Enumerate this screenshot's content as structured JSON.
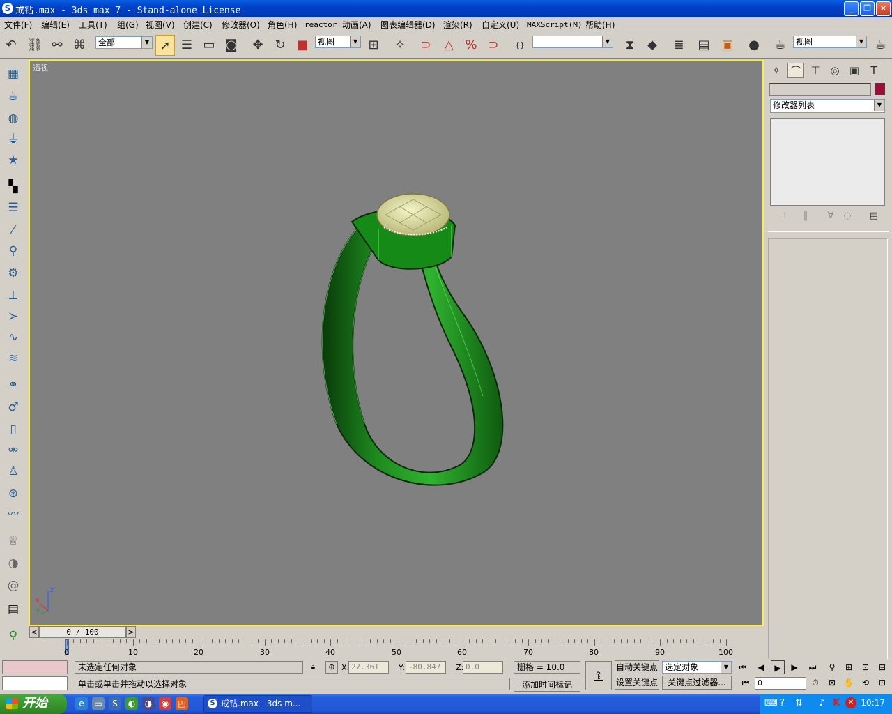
{
  "window": {
    "title": "戒钻.max - 3ds max 7  - Stand-alone License",
    "icon": "S"
  },
  "menu": [
    "文件(F)",
    "编辑(E)",
    "工具(T)",
    "组(G)",
    "视图(V)",
    "创建(C)",
    "修改器(O)",
    "角色(H)",
    "reactor",
    "动画(A)",
    "图表编辑器(D)",
    "渲染(R)",
    "自定义(U)",
    "MAXScript(M)",
    "帮助(H)"
  ],
  "toolbar": {
    "selection_filter": "全部",
    "ref_coord": "视图",
    "named_sel": "",
    "viewport_combo": "视图"
  },
  "viewport": {
    "label": "透视",
    "axis": {
      "x": "x",
      "y": "y",
      "z": "z"
    }
  },
  "command_panel": {
    "modifier_list": "修改器列表",
    "object_color": "#9a0f3a"
  },
  "timeline": {
    "slider_text": "0 / 100",
    "ticks": [
      "0",
      "10",
      "20",
      "30",
      "40",
      "50",
      "60",
      "70",
      "80",
      "90",
      "100"
    ]
  },
  "status": {
    "selection": "未选定任何对象",
    "prompt": "单击或单击并拖动以选择对象",
    "x_label": "X:",
    "x": "27.361",
    "y_label": "Y:",
    "y": "-80.847",
    "z_label": "Z:",
    "z": "0.0",
    "grid": "栅格 = 10.0",
    "add_time_tag": "添加时间标记",
    "auto_key": "自动关键点",
    "set_key": "设置关键点",
    "selected": "选定对象",
    "key_filters": "关键点过滤器...",
    "frame": "0"
  },
  "taskbar": {
    "start": "开始",
    "task": "戒钻.max - 3ds m...",
    "clock": "10:17"
  }
}
